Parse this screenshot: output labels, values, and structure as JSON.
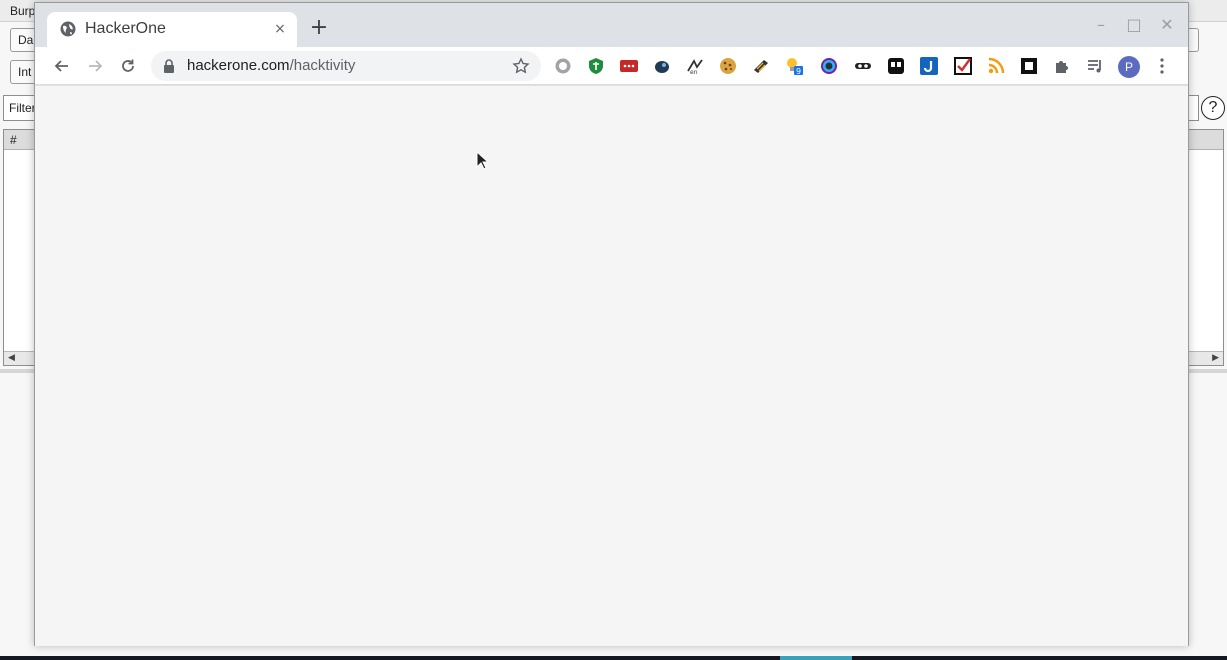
{
  "burp": {
    "title": "Burp",
    "tab_row1": "Da",
    "tab_row2": "Int",
    "filter_label": "Filter",
    "help": "?",
    "table_header": "#"
  },
  "browser": {
    "tab_title": "HackerOne",
    "tab_close": "×",
    "new_tab": "+",
    "url_host": "hackerone.com",
    "url_path": "/hacktivity",
    "avatar_letter": "P",
    "extension_badge": "9",
    "window_controls": {
      "minimize": "–",
      "maximize": "□",
      "close": "✕"
    }
  },
  "colors": {
    "accent_avatar": "#5c6bc0",
    "content_bg": "#f5f5f5",
    "tabstrip_bg": "#dee1e6"
  }
}
